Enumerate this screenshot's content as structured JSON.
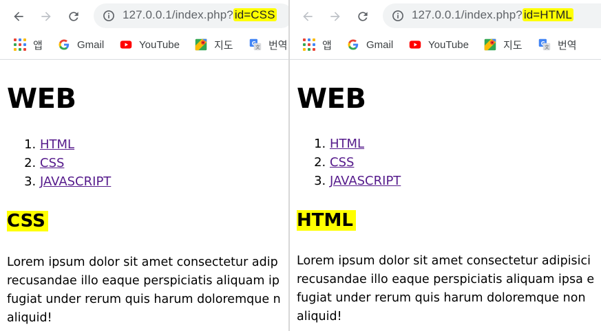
{
  "left": {
    "url_prefix": "127.0.0.1/index.php?",
    "url_query": "id=CSS",
    "bookmarks": [
      "앱",
      "Gmail",
      "YouTube",
      "지도",
      "번역"
    ],
    "page": {
      "heading": "WEB",
      "toc": [
        "HTML",
        "CSS",
        "JAVASCRIPT"
      ],
      "toc_numbers": [
        "1.",
        "2.",
        "3."
      ],
      "topic_title": "CSS",
      "body_lines": [
        "Lorem ipsum dolor sit amet consectetur adip",
        "recusandae illo eaque perspiciatis aliquam ip",
        "fugiat under rerum quis harum doloremque n",
        "aliquid!"
      ]
    }
  },
  "right": {
    "url_prefix": "127.0.0.1/index.php?",
    "url_query": "id=HTML",
    "bookmarks": [
      "앱",
      "Gmail",
      "YouTube",
      "지도",
      "번역"
    ],
    "page": {
      "heading": "WEB",
      "toc": [
        "HTML",
        "CSS",
        "JAVASCRIPT"
      ],
      "toc_numbers": [
        "1.",
        "2.",
        "3."
      ],
      "topic_title": "HTML",
      "body_lines": [
        "Lorem ipsum dolor sit amet consectetur adipisici",
        "recusandae illo eaque perspiciatis aliquam ipsa e",
        "fugiat under rerum quis harum doloremque non",
        "aliquid!"
      ]
    }
  },
  "colors": {
    "highlight": "#ffff00",
    "link_visited": "#551a8b",
    "omnibox_bg": "#f1f3f4",
    "youtube_red": "#ff0000"
  },
  "icons": {
    "back": "back-arrow-icon",
    "forward": "forward-arrow-icon",
    "reload": "reload-icon",
    "info": "info-icon",
    "apps": "apps-grid-icon",
    "gmail": "google-g-icon",
    "youtube": "youtube-icon",
    "maps": "maps-icon",
    "translate": "translate-icon"
  }
}
